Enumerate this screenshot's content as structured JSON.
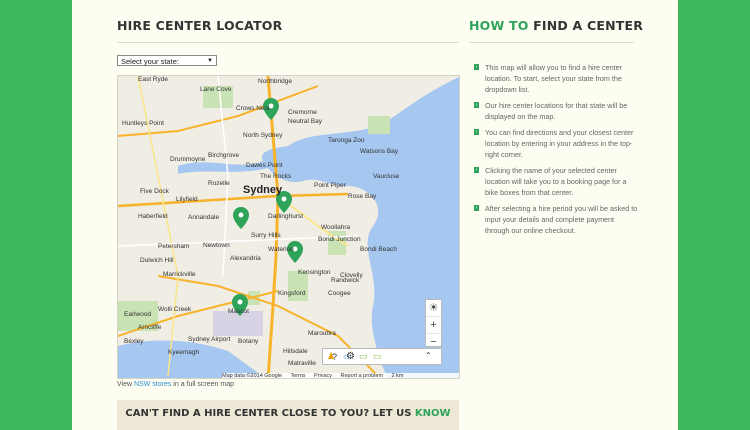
{
  "left": {
    "title": "HIRE CENTER LOCATOR",
    "select_value": "Select your state:",
    "select_arrow": "▼",
    "map_link_prefix": "View",
    "map_link_text": "NSW stores",
    "map_link_suffix": "in a full screen map"
  },
  "right": {
    "title_green": "HOW TO",
    "title_rest": "FIND A CENTER",
    "steps": [
      "This map will allow you to find a hire center location. To start, select your state from the dropdown list.",
      "Our hire center locations for that state will be displayed on the map.",
      "You can find directions and your closest center location by entering in your address in the top-right corner.",
      "Clicking the name of your selected center location will take you to a booking page for a bike boxes from that center.",
      "After selecting a hire period you will be asked to input your details and complete payment through our online checkout."
    ]
  },
  "banner": {
    "text": "CAN'T FIND A HIRE CENTER CLOSE TO YOU? LET US",
    "highlight": "KNOW"
  },
  "map": {
    "city": "Sydney",
    "labels": {
      "northbridge": "Northbridge",
      "lane_cove": "Lane Cove",
      "crows_nest": "Crows Nest",
      "cremorne": "Cremorne",
      "neutral_bay": "Neutral Bay",
      "north_sydney": "North Sydney",
      "taronga": "Taronga Zoo",
      "watsons": "Watsons Bay",
      "drummoyne": "Drummoyne",
      "birchgrove": "Birchgrove",
      "dawes": "Dawes Point",
      "rocks": "The Rocks",
      "five_dock": "Five Dock",
      "rozelle": "Rozelle",
      "point_piper": "Point Piper",
      "rose_bay": "Rose Bay",
      "vaucluse": "Vaucluse",
      "lilyfield": "Lilyfield",
      "darlinghurst": "Darlinghurst",
      "glebe": "Glebe",
      "haberfield": "Haberfield",
      "annandale": "Annandale",
      "surry_hills": "Surry Hills",
      "woollahra": "Woollahra",
      "bondi_junction": "Bondi Junction",
      "petersham": "Petersham",
      "newtown": "Newtown",
      "waterloo": "Waterloo",
      "bondi": "Bondi Beach",
      "dulwich": "Dulwich Hill",
      "alexandria": "Alexandria",
      "marrickville": "Marrickville",
      "kensington": "Kensington",
      "randwick": "Randwick",
      "clovelly": "Clovelly",
      "earlwood": "Earlwood",
      "wolli": "Wolli Creek",
      "mascot": "Mascot",
      "kingsford": "Kingsford",
      "coogee": "Coogee",
      "arncliffe": "Arncliffe",
      "maroubra": "Maroubra",
      "airport": "Sydney Airport",
      "botany": "Botany",
      "kyeemagh": "Kyeemagh",
      "bexley": "Bexley",
      "hillsdale": "Hillsdale",
      "matraville": "Matraville",
      "huntleys": "Huntleys Point",
      "red_ryde": "East Ryde"
    },
    "attribution": [
      "Map data ©2014 Google",
      "Terms",
      "Privacy",
      "Report a problem",
      "2 km"
    ]
  }
}
